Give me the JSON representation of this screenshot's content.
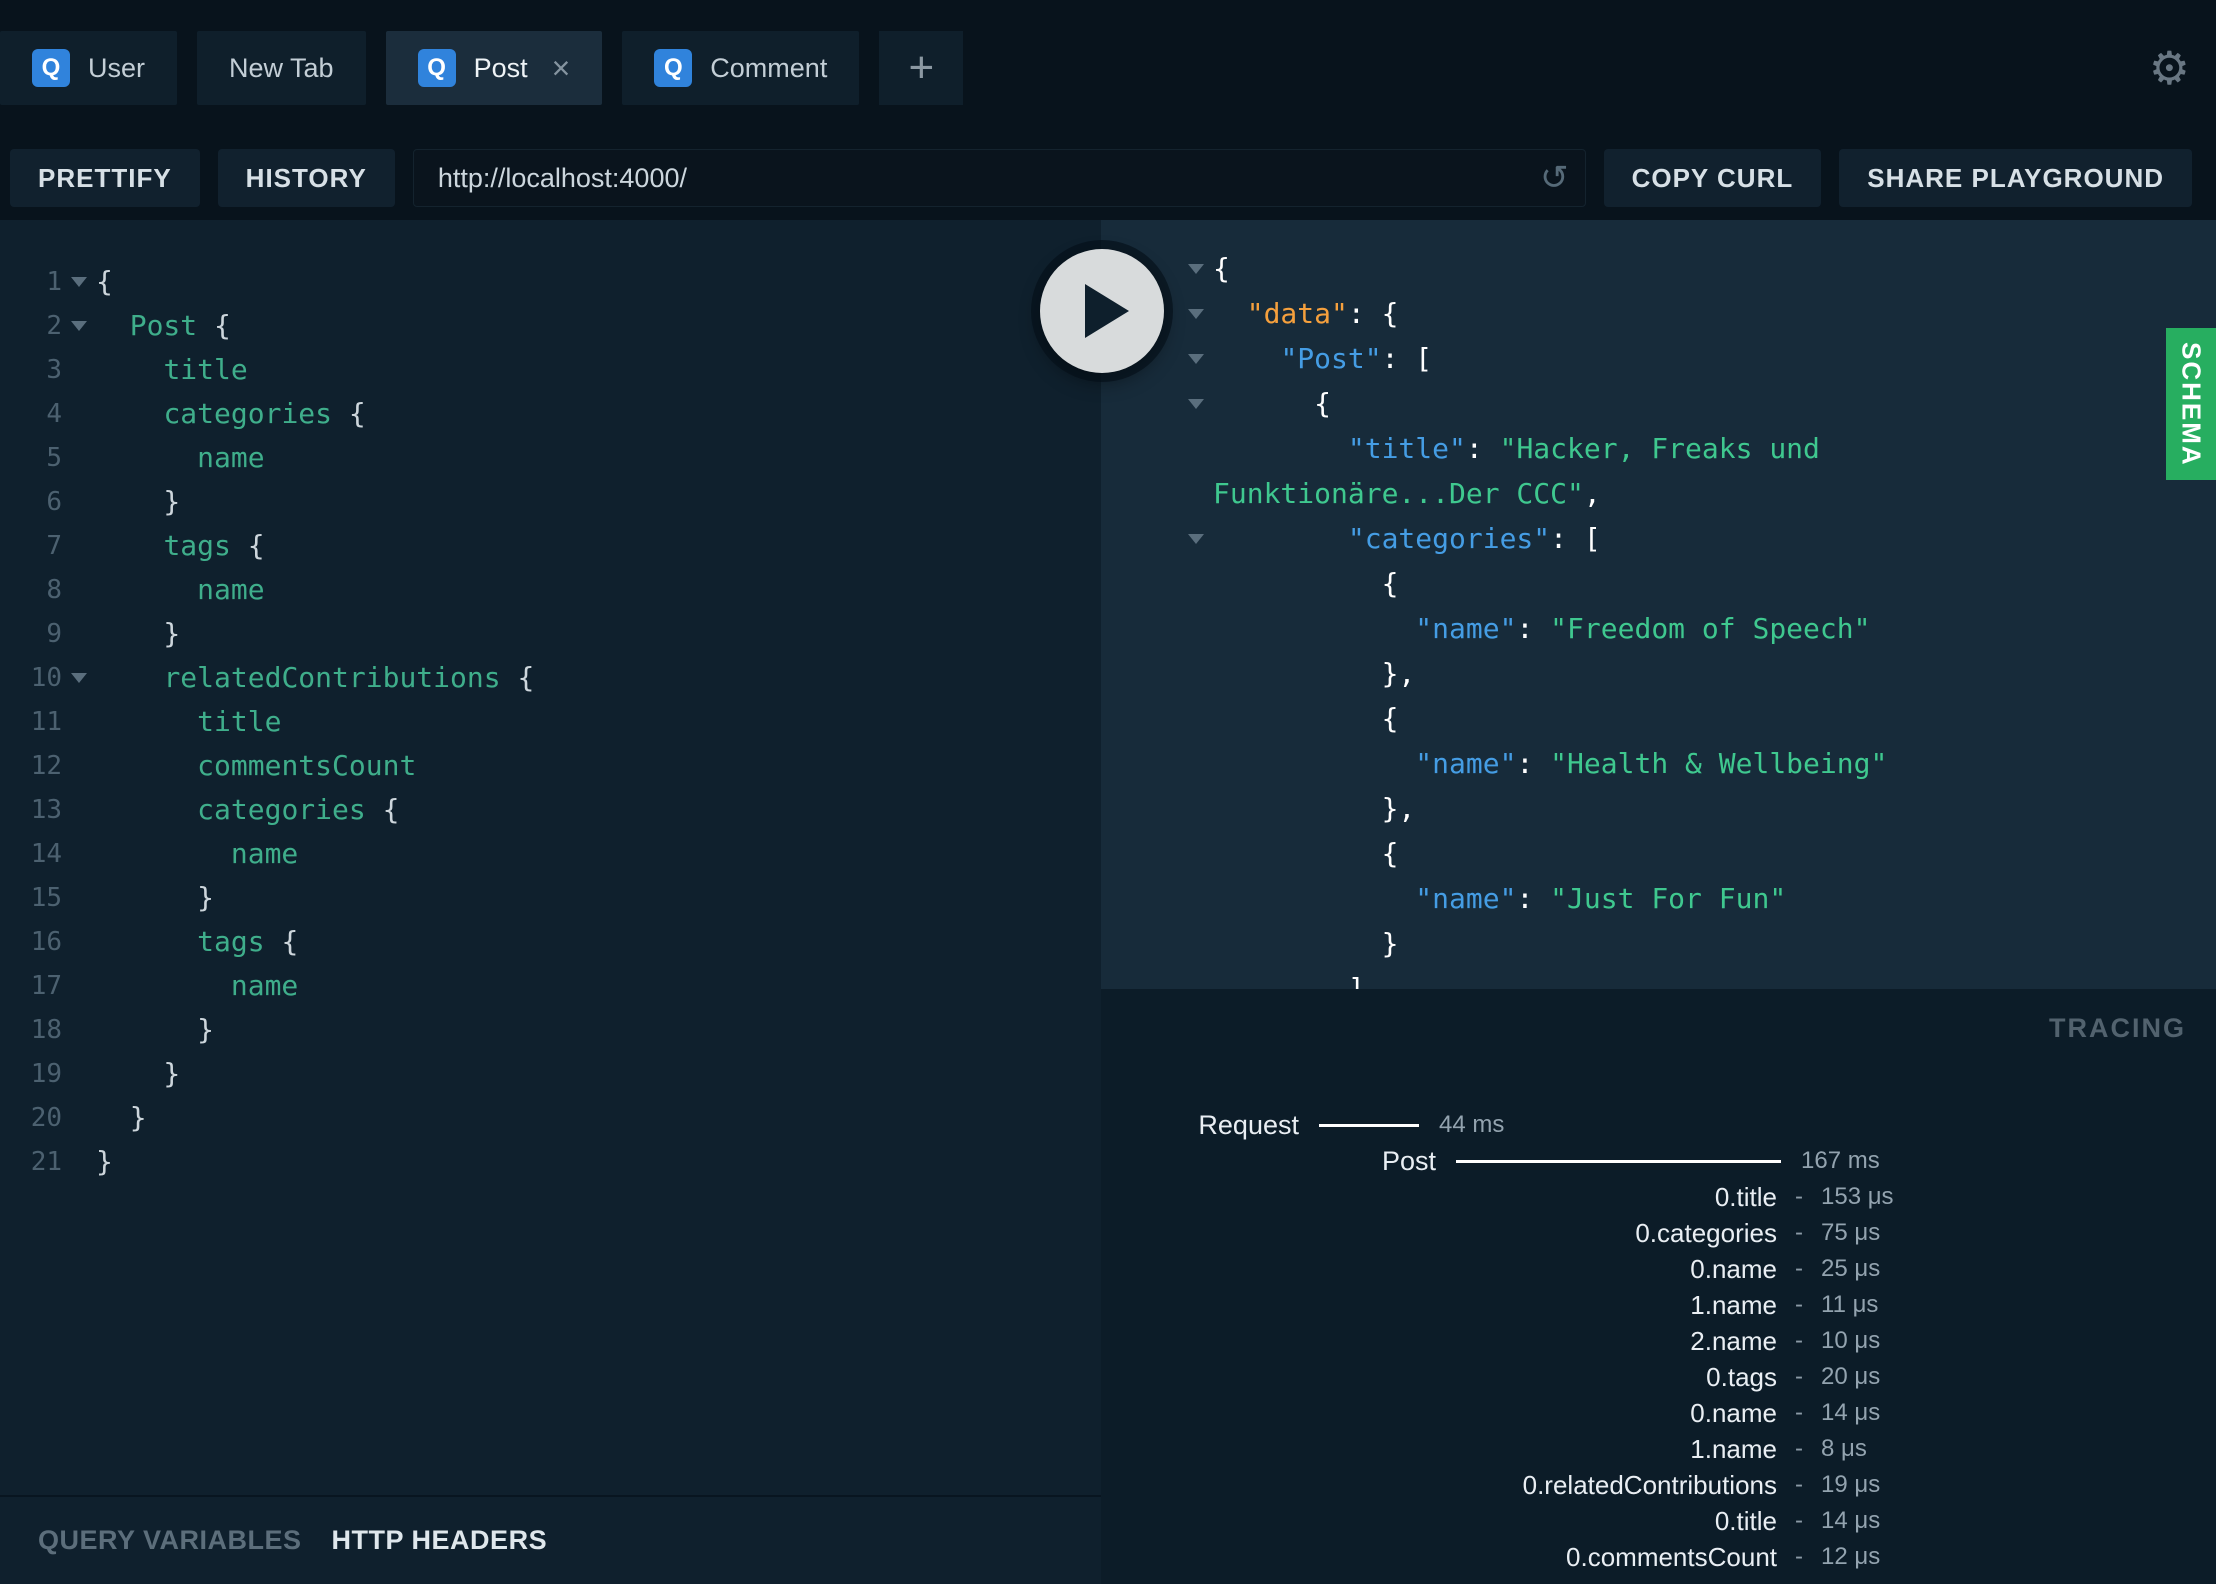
{
  "colors": {
    "schema_green": "#27ae60",
    "badge_blue": "#3083dc",
    "query_field_green": "#3fae8b",
    "result_key_blue": "#459de4",
    "result_root_key_orange": "#f5a03d",
    "result_value_green": "#3fc88f"
  },
  "icons": {
    "gear": "⚙",
    "close": "×",
    "plus": "+",
    "reload": "↺",
    "badge": "Q",
    "play": "play-triangle",
    "fold": "chevron-down"
  },
  "tabs": [
    {
      "label": "User",
      "badge": "Q",
      "active": false,
      "closable": false
    },
    {
      "label": "New Tab",
      "badge": null,
      "active": false,
      "closable": false
    },
    {
      "label": "Post",
      "badge": "Q",
      "active": true,
      "closable": true
    },
    {
      "label": "Comment",
      "badge": "Q",
      "active": false,
      "closable": false
    }
  ],
  "toolbar": {
    "prettify": "PRETTIFY",
    "history": "HISTORY",
    "url": "http://localhost:4000/",
    "copy_curl": "COPY CURL",
    "share": "SHARE PLAYGROUND"
  },
  "query_editor": {
    "lines": [
      {
        "n": 1,
        "fold": true,
        "seg": [
          [
            "p",
            "{"
          ]
        ]
      },
      {
        "n": 2,
        "fold": true,
        "seg": [
          [
            "p",
            "  "
          ],
          [
            "f",
            "Post"
          ],
          [
            "p",
            " {"
          ]
        ]
      },
      {
        "n": 3,
        "fold": false,
        "seg": [
          [
            "p",
            "    "
          ],
          [
            "f",
            "title"
          ]
        ]
      },
      {
        "n": 4,
        "fold": false,
        "seg": [
          [
            "p",
            "    "
          ],
          [
            "f",
            "categories"
          ],
          [
            "p",
            " {"
          ]
        ]
      },
      {
        "n": 5,
        "fold": false,
        "seg": [
          [
            "p",
            "      "
          ],
          [
            "f",
            "name"
          ]
        ]
      },
      {
        "n": 6,
        "fold": false,
        "seg": [
          [
            "p",
            "    }"
          ]
        ]
      },
      {
        "n": 7,
        "fold": false,
        "seg": [
          [
            "p",
            "    "
          ],
          [
            "f",
            "tags"
          ],
          [
            "p",
            " {"
          ]
        ]
      },
      {
        "n": 8,
        "fold": false,
        "seg": [
          [
            "p",
            "      "
          ],
          [
            "f",
            "name"
          ]
        ]
      },
      {
        "n": 9,
        "fold": false,
        "seg": [
          [
            "p",
            "    }"
          ]
        ]
      },
      {
        "n": 10,
        "fold": true,
        "seg": [
          [
            "p",
            "    "
          ],
          [
            "f",
            "relatedContributions"
          ],
          [
            "p",
            " {"
          ]
        ]
      },
      {
        "n": 11,
        "fold": false,
        "seg": [
          [
            "p",
            "      "
          ],
          [
            "f",
            "title"
          ]
        ]
      },
      {
        "n": 12,
        "fold": false,
        "seg": [
          [
            "p",
            "      "
          ],
          [
            "f",
            "commentsCount"
          ]
        ]
      },
      {
        "n": 13,
        "fold": false,
        "seg": [
          [
            "p",
            "      "
          ],
          [
            "f",
            "categories"
          ],
          [
            "p",
            " {"
          ]
        ]
      },
      {
        "n": 14,
        "fold": false,
        "seg": [
          [
            "p",
            "        "
          ],
          [
            "f",
            "name"
          ]
        ]
      },
      {
        "n": 15,
        "fold": false,
        "seg": [
          [
            "p",
            "      }"
          ]
        ]
      },
      {
        "n": 16,
        "fold": false,
        "seg": [
          [
            "p",
            "      "
          ],
          [
            "f",
            "tags"
          ],
          [
            "p",
            " {"
          ]
        ]
      },
      {
        "n": 17,
        "fold": false,
        "seg": [
          [
            "p",
            "        "
          ],
          [
            "f",
            "name"
          ]
        ]
      },
      {
        "n": 18,
        "fold": false,
        "seg": [
          [
            "p",
            "      }"
          ]
        ]
      },
      {
        "n": 19,
        "fold": false,
        "seg": [
          [
            "p",
            "    }"
          ]
        ]
      },
      {
        "n": 20,
        "fold": false,
        "seg": [
          [
            "p",
            "  }"
          ]
        ]
      },
      {
        "n": 21,
        "fold": false,
        "seg": [
          [
            "p",
            "}"
          ]
        ]
      }
    ]
  },
  "result_viewer": {
    "lines": [
      {
        "fold": true,
        "seg": [
          [
            "w",
            "{"
          ]
        ]
      },
      {
        "fold": true,
        "seg": [
          [
            "w",
            "  "
          ],
          [
            "d",
            "\"data\""
          ],
          [
            "w",
            ": {"
          ]
        ]
      },
      {
        "fold": true,
        "seg": [
          [
            "w",
            "    "
          ],
          [
            "k",
            "\"Post\""
          ],
          [
            "w",
            ": ["
          ]
        ]
      },
      {
        "fold": true,
        "seg": [
          [
            "w",
            "      {"
          ]
        ]
      },
      {
        "fold": false,
        "seg": [
          [
            "w",
            "        "
          ],
          [
            "k",
            "\"title\""
          ],
          [
            "w",
            ": "
          ],
          [
            "v",
            "\"Hacker, Freaks und"
          ]
        ]
      },
      {
        "fold": false,
        "seg": [
          [
            "v",
            "Funktionäre...Der CCC\""
          ],
          [
            "w",
            ","
          ]
        ]
      },
      {
        "fold": true,
        "seg": [
          [
            "w",
            "        "
          ],
          [
            "k",
            "\"categories\""
          ],
          [
            "w",
            ": ["
          ]
        ]
      },
      {
        "fold": false,
        "seg": [
          [
            "w",
            "          {"
          ]
        ]
      },
      {
        "fold": false,
        "seg": [
          [
            "w",
            "            "
          ],
          [
            "k",
            "\"name\""
          ],
          [
            "w",
            ": "
          ],
          [
            "v",
            "\"Freedom of Speech\""
          ]
        ]
      },
      {
        "fold": false,
        "seg": [
          [
            "w",
            "          },"
          ]
        ]
      },
      {
        "fold": false,
        "seg": [
          [
            "w",
            "          {"
          ]
        ]
      },
      {
        "fold": false,
        "seg": [
          [
            "w",
            "            "
          ],
          [
            "k",
            "\"name\""
          ],
          [
            "w",
            ": "
          ],
          [
            "v",
            "\"Health & Wellbeing\""
          ]
        ]
      },
      {
        "fold": false,
        "seg": [
          [
            "w",
            "          },"
          ]
        ]
      },
      {
        "fold": false,
        "seg": [
          [
            "w",
            "          {"
          ]
        ]
      },
      {
        "fold": false,
        "seg": [
          [
            "w",
            "            "
          ],
          [
            "k",
            "\"name\""
          ],
          [
            "w",
            ": "
          ],
          [
            "v",
            "\"Just For Fun\""
          ]
        ]
      },
      {
        "fold": false,
        "seg": [
          [
            "w",
            "          }"
          ]
        ]
      },
      {
        "fold": false,
        "seg": [
          [
            "w",
            "        ],"
          ]
        ]
      }
    ]
  },
  "schema_tab": {
    "label": "SCHEMA"
  },
  "tracing": {
    "title": "TRACING",
    "request": {
      "label": "Request",
      "time": "44 ms"
    },
    "post": {
      "label": "Post",
      "time": "167 ms"
    },
    "spans": [
      {
        "label": "0.title",
        "time": "153 μs"
      },
      {
        "label": "0.categories",
        "time": "75 μs"
      },
      {
        "label": "0.name",
        "time": "25 μs"
      },
      {
        "label": "1.name",
        "time": "11 μs"
      },
      {
        "label": "2.name",
        "time": "10 μs"
      },
      {
        "label": "0.tags",
        "time": "20 μs"
      },
      {
        "label": "0.name",
        "time": "14 μs"
      },
      {
        "label": "1.name",
        "time": "8 μs"
      },
      {
        "label": "0.relatedContributions",
        "time": "19 μs"
      },
      {
        "label": "0.title",
        "time": "14 μs"
      },
      {
        "label": "0.commentsCount",
        "time": "12 μs"
      }
    ]
  },
  "bottom_bar": {
    "query_variables": "QUERY VARIABLES",
    "http_headers": "HTTP HEADERS"
  }
}
